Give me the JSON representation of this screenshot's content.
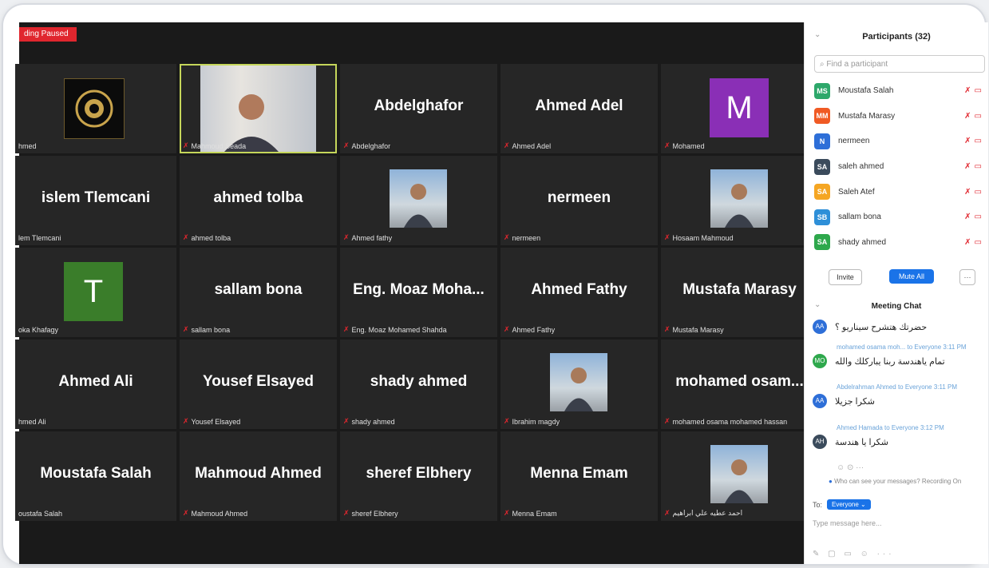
{
  "recording_badge": "ding Paused",
  "tiles": [
    {
      "name": "",
      "caption": "hmed",
      "kind": "logo"
    },
    {
      "name": "",
      "caption": "Mahmoud Seada",
      "kind": "photo",
      "active": true
    },
    {
      "name": "Abdelghafor",
      "caption": "Abdelghafor"
    },
    {
      "name": "Ahmed Adel",
      "caption": "Ahmed Adel"
    },
    {
      "name": "",
      "caption": "Mohamed",
      "kind": "letter",
      "letter": "M",
      "color": "#8a2fb6"
    },
    {
      "name": "islem Tlemcani",
      "caption": "lem Tlemcani"
    },
    {
      "name": "ahmed tolba",
      "caption": "ahmed tolba"
    },
    {
      "name": "",
      "caption": "Ahmed fathy",
      "kind": "photo"
    },
    {
      "name": "nermeen",
      "caption": "nermeen"
    },
    {
      "name": "",
      "caption": "Hosaam Mahmoud",
      "kind": "photo"
    },
    {
      "name": "",
      "caption": "oka Khafagy",
      "kind": "letter",
      "letter": "T",
      "color": "#3a7d2a"
    },
    {
      "name": "sallam bona",
      "caption": "sallam bona"
    },
    {
      "name": "Eng. Moaz Moha...",
      "caption": "Eng. Moaz Mohamed Shahda"
    },
    {
      "name": "Ahmed Fathy",
      "caption": "Ahmed Fathy"
    },
    {
      "name": "Mustafa Marasy",
      "caption": "Mustafa Marasy"
    },
    {
      "name": "Ahmed Ali",
      "caption": "hmed Ali"
    },
    {
      "name": "Yousef Elsayed",
      "caption": "Yousef Elsayed"
    },
    {
      "name": "shady ahmed",
      "caption": "shady ahmed"
    },
    {
      "name": "",
      "caption": "Ibrahim magdy",
      "kind": "photo"
    },
    {
      "name": "mohamed osam...",
      "caption": "mohamed osama mohamed hassan"
    },
    {
      "name": "Moustafa Salah",
      "caption": "oustafa Salah"
    },
    {
      "name": "Mahmoud Ahmed",
      "caption": "Mahmoud Ahmed"
    },
    {
      "name": "sheref Elbhery",
      "caption": "sheref Elbhery"
    },
    {
      "name": "Menna Emam",
      "caption": "Menna Emam"
    },
    {
      "name": "",
      "caption": "احمد عطيه علي ابراهيم",
      "kind": "photo"
    }
  ],
  "participants": {
    "title": "Participants (32)",
    "search_placeholder": "Find a participant",
    "list": [
      {
        "initials": "MS",
        "name": "Moustafa Salah",
        "color": "#2ea86b"
      },
      {
        "initials": "MM",
        "name": "Mustafa Marasy",
        "color": "#f05a24"
      },
      {
        "initials": "N",
        "name": "nermeen",
        "color": "#2e6fd8"
      },
      {
        "initials": "SA",
        "name": "saleh ahmed",
        "color": "#3b4b5c"
      },
      {
        "initials": "SA",
        "name": "Saleh Atef",
        "color": "#f5a623"
      },
      {
        "initials": "SB",
        "name": "sallam bona",
        "color": "#2e8fd8"
      },
      {
        "initials": "SA",
        "name": "shady ahmed",
        "color": "#2ea84c"
      }
    ],
    "invite": "Invite",
    "mute_all": "Mute All",
    "more": "···"
  },
  "chat": {
    "title": "Meeting Chat",
    "messages": [
      {
        "meta": "",
        "initials": "AA",
        "color": "#2e6fd8",
        "text": "حضرتك هتشرح سيناريو ؟"
      },
      {
        "meta": "mohamed osama moh... to Everyone 3:11 PM",
        "initials": "MO",
        "color": "#2ea84c",
        "text": "تمام ياهندسة ربنا يباركلك والله"
      },
      {
        "meta": "Abdelrahman Ahmed to Everyone 3:11 PM",
        "initials": "AA",
        "color": "#2e6fd8",
        "text": "شكرا جزيلا"
      },
      {
        "meta": "Ahmed Hamada to Everyone 3:12 PM",
        "initials": "AH",
        "color": "#3b4b5c",
        "text": "شكرا يا هندسة"
      }
    ],
    "hint": "Who can see your messages? Recording On",
    "to_label": "To:",
    "to_value": "Everyone ⌄",
    "placeholder": "Type message here..."
  }
}
